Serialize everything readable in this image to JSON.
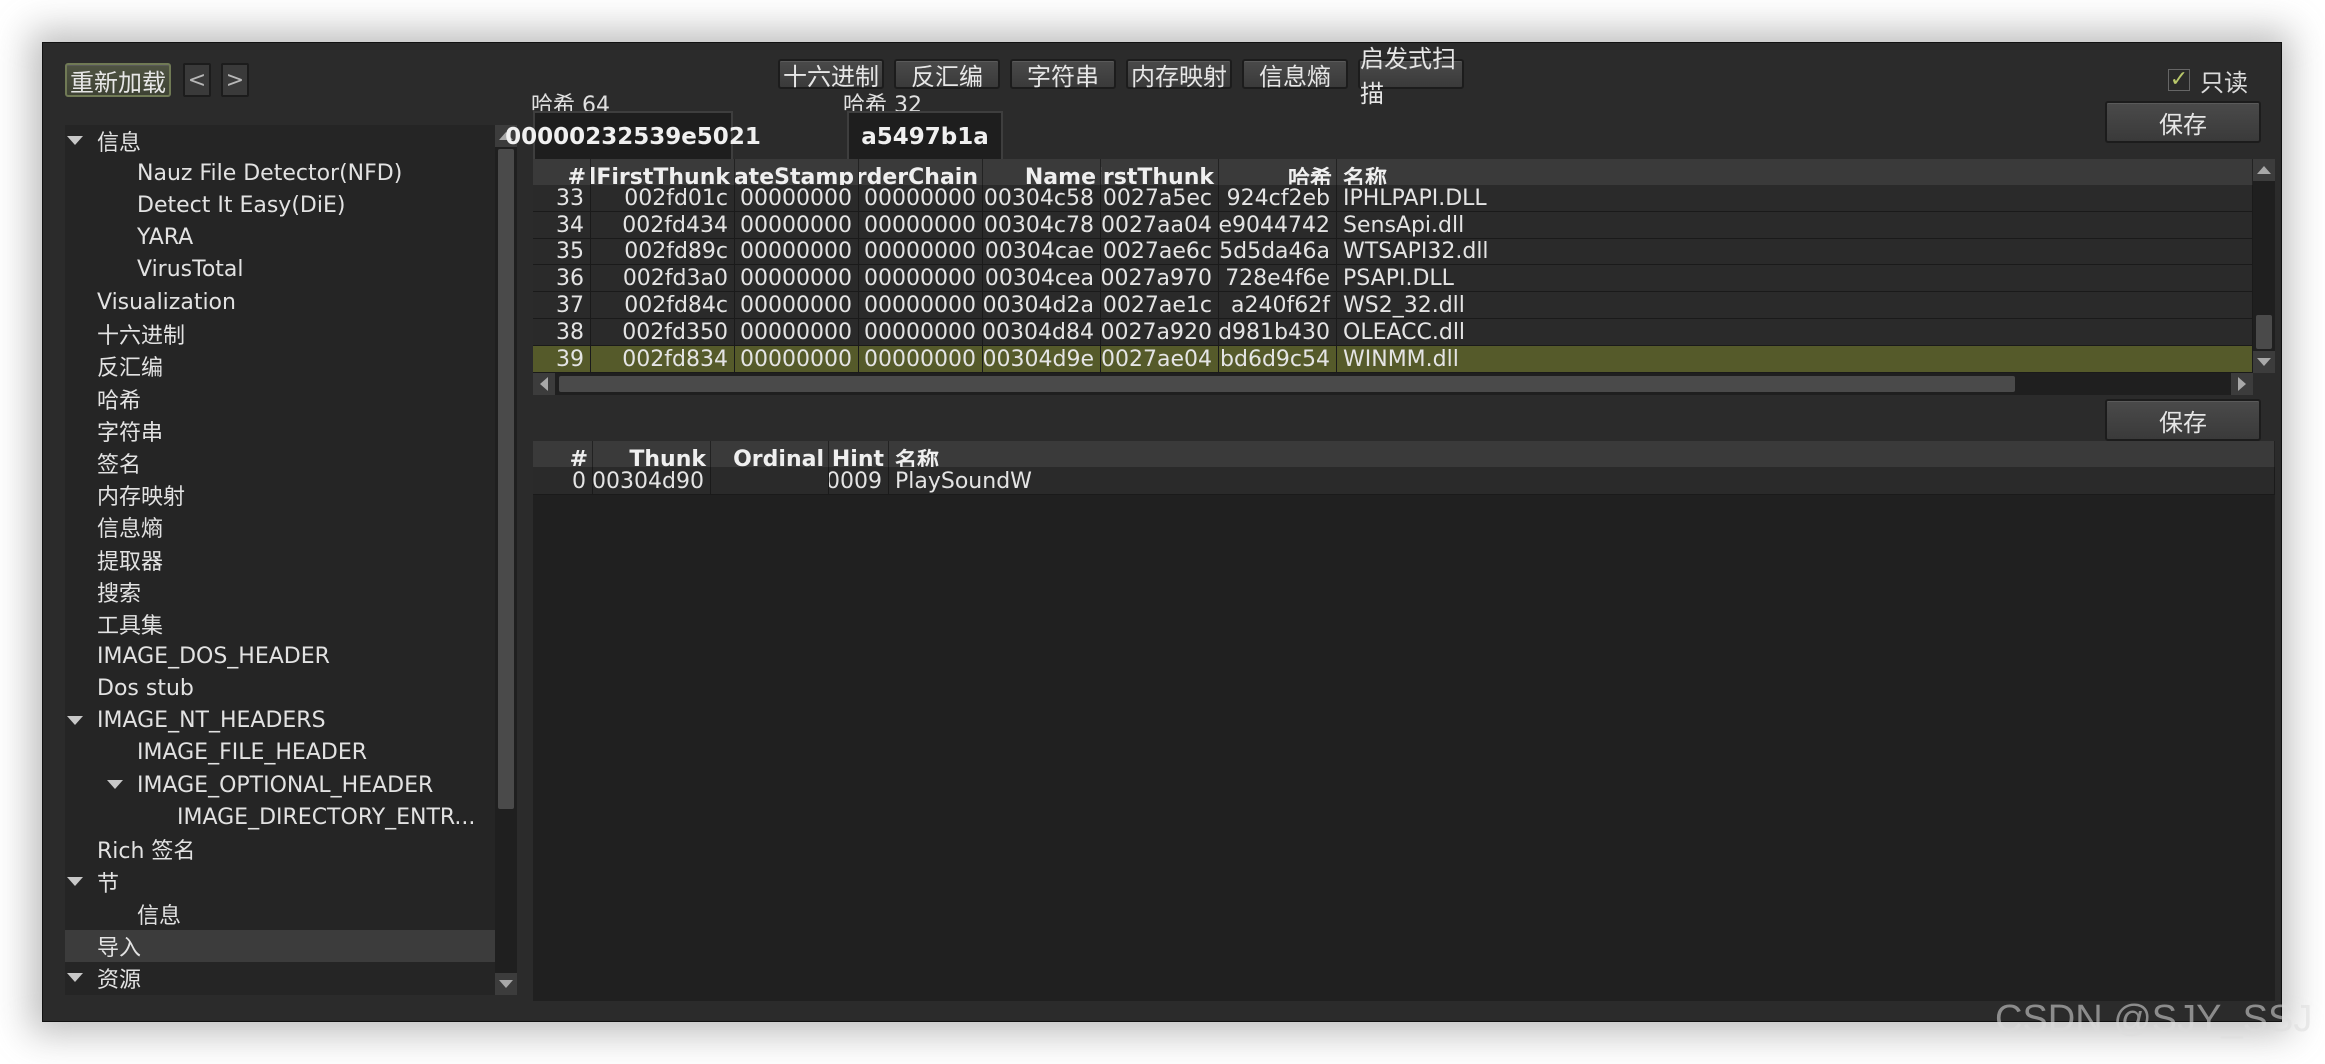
{
  "toolbar": {
    "reload_label": "重新加载",
    "back_label": "<",
    "forward_label": ">",
    "buttons": [
      "十六进制",
      "反汇编",
      "字符串",
      "内存映射",
      "信息熵",
      "启发式扫描"
    ],
    "readonly_label": "只读",
    "readonly_checked": true,
    "readonly_check_glyph": "✓"
  },
  "tree": {
    "items": [
      {
        "label": "信息",
        "depth": 0,
        "expanded": true
      },
      {
        "label": "Nauz File Detector(NFD)",
        "depth": 1
      },
      {
        "label": "Detect It Easy(DiE)",
        "depth": 1
      },
      {
        "label": "YARA",
        "depth": 1
      },
      {
        "label": "VirusTotal",
        "depth": 1
      },
      {
        "label": "Visualization",
        "depth": 0
      },
      {
        "label": "十六进制",
        "depth": 0
      },
      {
        "label": "反汇编",
        "depth": 0
      },
      {
        "label": "哈希",
        "depth": 0
      },
      {
        "label": "字符串",
        "depth": 0
      },
      {
        "label": "签名",
        "depth": 0
      },
      {
        "label": "内存映射",
        "depth": 0
      },
      {
        "label": "信息熵",
        "depth": 0
      },
      {
        "label": "提取器",
        "depth": 0
      },
      {
        "label": "搜索",
        "depth": 0
      },
      {
        "label": "工具集",
        "depth": 0
      },
      {
        "label": "IMAGE_DOS_HEADER",
        "depth": 0
      },
      {
        "label": "Dos stub",
        "depth": 0
      },
      {
        "label": "IMAGE_NT_HEADERS",
        "depth": 0,
        "expanded": true
      },
      {
        "label": "IMAGE_FILE_HEADER",
        "depth": 1
      },
      {
        "label": "IMAGE_OPTIONAL_HEADER",
        "depth": 1,
        "expanded": true
      },
      {
        "label": "IMAGE_DIRECTORY_ENTR...",
        "depth": 2
      },
      {
        "label": "Rich 签名",
        "depth": 0
      },
      {
        "label": "节",
        "depth": 0,
        "expanded": true
      },
      {
        "label": "信息",
        "depth": 1
      },
      {
        "label": "导入",
        "depth": 0,
        "selected": true
      },
      {
        "label": "资源",
        "depth": 0,
        "expanded": true
      }
    ]
  },
  "hash": {
    "hash64_label": "哈希 64",
    "hash64_value": "00000232539e5021",
    "hash32_label": "哈希 32",
    "hash32_value": "a5497b1a",
    "save_label": "保存"
  },
  "imports_table": {
    "columns": [
      "#",
      "OriginalFirstThunk",
      "TimeDateStamp",
      "ForwarderChain",
      "Name",
      "FirstThunk",
      "哈希",
      "名称"
    ],
    "rows": [
      [
        "33",
        "002fd01c",
        "00000000",
        "00000000",
        "00304c58",
        "0027a5ec",
        "924cf2eb",
        "IPHLPAPI.DLL"
      ],
      [
        "34",
        "002fd434",
        "00000000",
        "00000000",
        "00304c78",
        "0027aa04",
        "e9044742",
        "SensApi.dll"
      ],
      [
        "35",
        "002fd89c",
        "00000000",
        "00000000",
        "00304cae",
        "0027ae6c",
        "5d5da46a",
        "WTSAPI32.dll"
      ],
      [
        "36",
        "002fd3a0",
        "00000000",
        "00000000",
        "00304cea",
        "0027a970",
        "728e4f6e",
        "PSAPI.DLL"
      ],
      [
        "37",
        "002fd84c",
        "00000000",
        "00000000",
        "00304d2a",
        "0027ae1c",
        "a240f62f",
        "WS2_32.dll"
      ],
      [
        "38",
        "002fd350",
        "00000000",
        "00000000",
        "00304d84",
        "0027a920",
        "d981b430",
        "OLEACC.dll"
      ],
      [
        "39",
        "002fd834",
        "00000000",
        "00000000",
        "00304d9e",
        "0027ae04",
        "bd6d9c54",
        "WINMM.dll"
      ]
    ],
    "selected_row": 6
  },
  "functions": {
    "save_label": "保存",
    "columns": [
      "#",
      "Thunk",
      "Ordinal",
      "Hint",
      "名称"
    ],
    "rows": [
      [
        "0",
        "00304d90",
        "",
        "0009",
        "PlaySoundW"
      ]
    ]
  },
  "watermark": "CSDN @SJY_SSJ",
  "colors": {
    "selected_row": "#555a2a",
    "window_bg": "#2b2b2b",
    "checkbox_check": "#b9c86a"
  }
}
